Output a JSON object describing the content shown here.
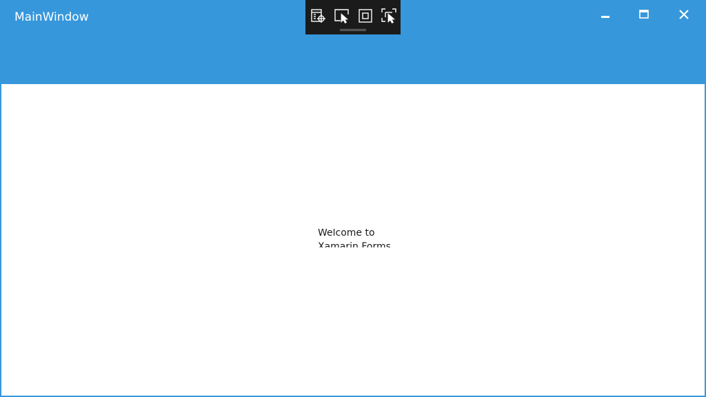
{
  "window": {
    "title": "MainWindow"
  },
  "devtools": {
    "buttons": [
      {
        "icon": "live-visual-tree-icon"
      },
      {
        "icon": "select-element-icon"
      },
      {
        "icon": "display-layout-adorners-icon"
      },
      {
        "icon": "track-focused-element-icon"
      }
    ]
  },
  "caption_buttons": {
    "minimize": "minimize-icon",
    "maximize": "maximize-icon",
    "close": "close-icon"
  },
  "content": {
    "welcome_label": "Welcome to Xamarin.Forms!"
  },
  "colors": {
    "title_bar": "#3797db",
    "devtools_bar": "#1b1b1b",
    "content_background": "#ffffff",
    "text": "#1a1a1a"
  }
}
